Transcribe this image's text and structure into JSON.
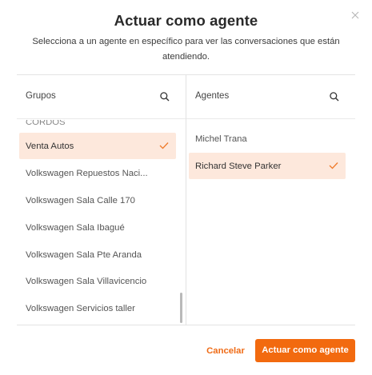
{
  "dialog": {
    "title": "Actuar como agente",
    "subtitle": "Selecciona a un agente en específico para ver las conversaciones que están atendiendo.",
    "close_icon": "close-icon"
  },
  "groups": {
    "header": "Grupos",
    "search_icon": "search-icon",
    "cut_item": "CORDOS",
    "items": [
      {
        "label": "Venta Autos",
        "selected": true
      },
      {
        "label": "Volkswagen Repuestos Naci...",
        "selected": false
      },
      {
        "label": "Volkswagen Sala Calle 170",
        "selected": false
      },
      {
        "label": "Volkswagen Sala Ibagué",
        "selected": false
      },
      {
        "label": "Volkswagen Sala Pte Aranda",
        "selected": false
      },
      {
        "label": "Volkswagen Sala Villavicencio",
        "selected": false
      },
      {
        "label": "Volkswagen Servicios taller",
        "selected": false
      }
    ]
  },
  "agents": {
    "header": "Agentes",
    "search_icon": "search-icon",
    "items": [
      {
        "label": "Michel Trana",
        "selected": false
      },
      {
        "label": "Richard Steve Parker",
        "selected": true
      }
    ]
  },
  "footer": {
    "cancel_label": "Cancelar",
    "confirm_label": "Actuar como agente"
  },
  "colors": {
    "accent": "#f26a0f",
    "selected_bg": "#fde8dc",
    "check": "#ef7a2a"
  }
}
